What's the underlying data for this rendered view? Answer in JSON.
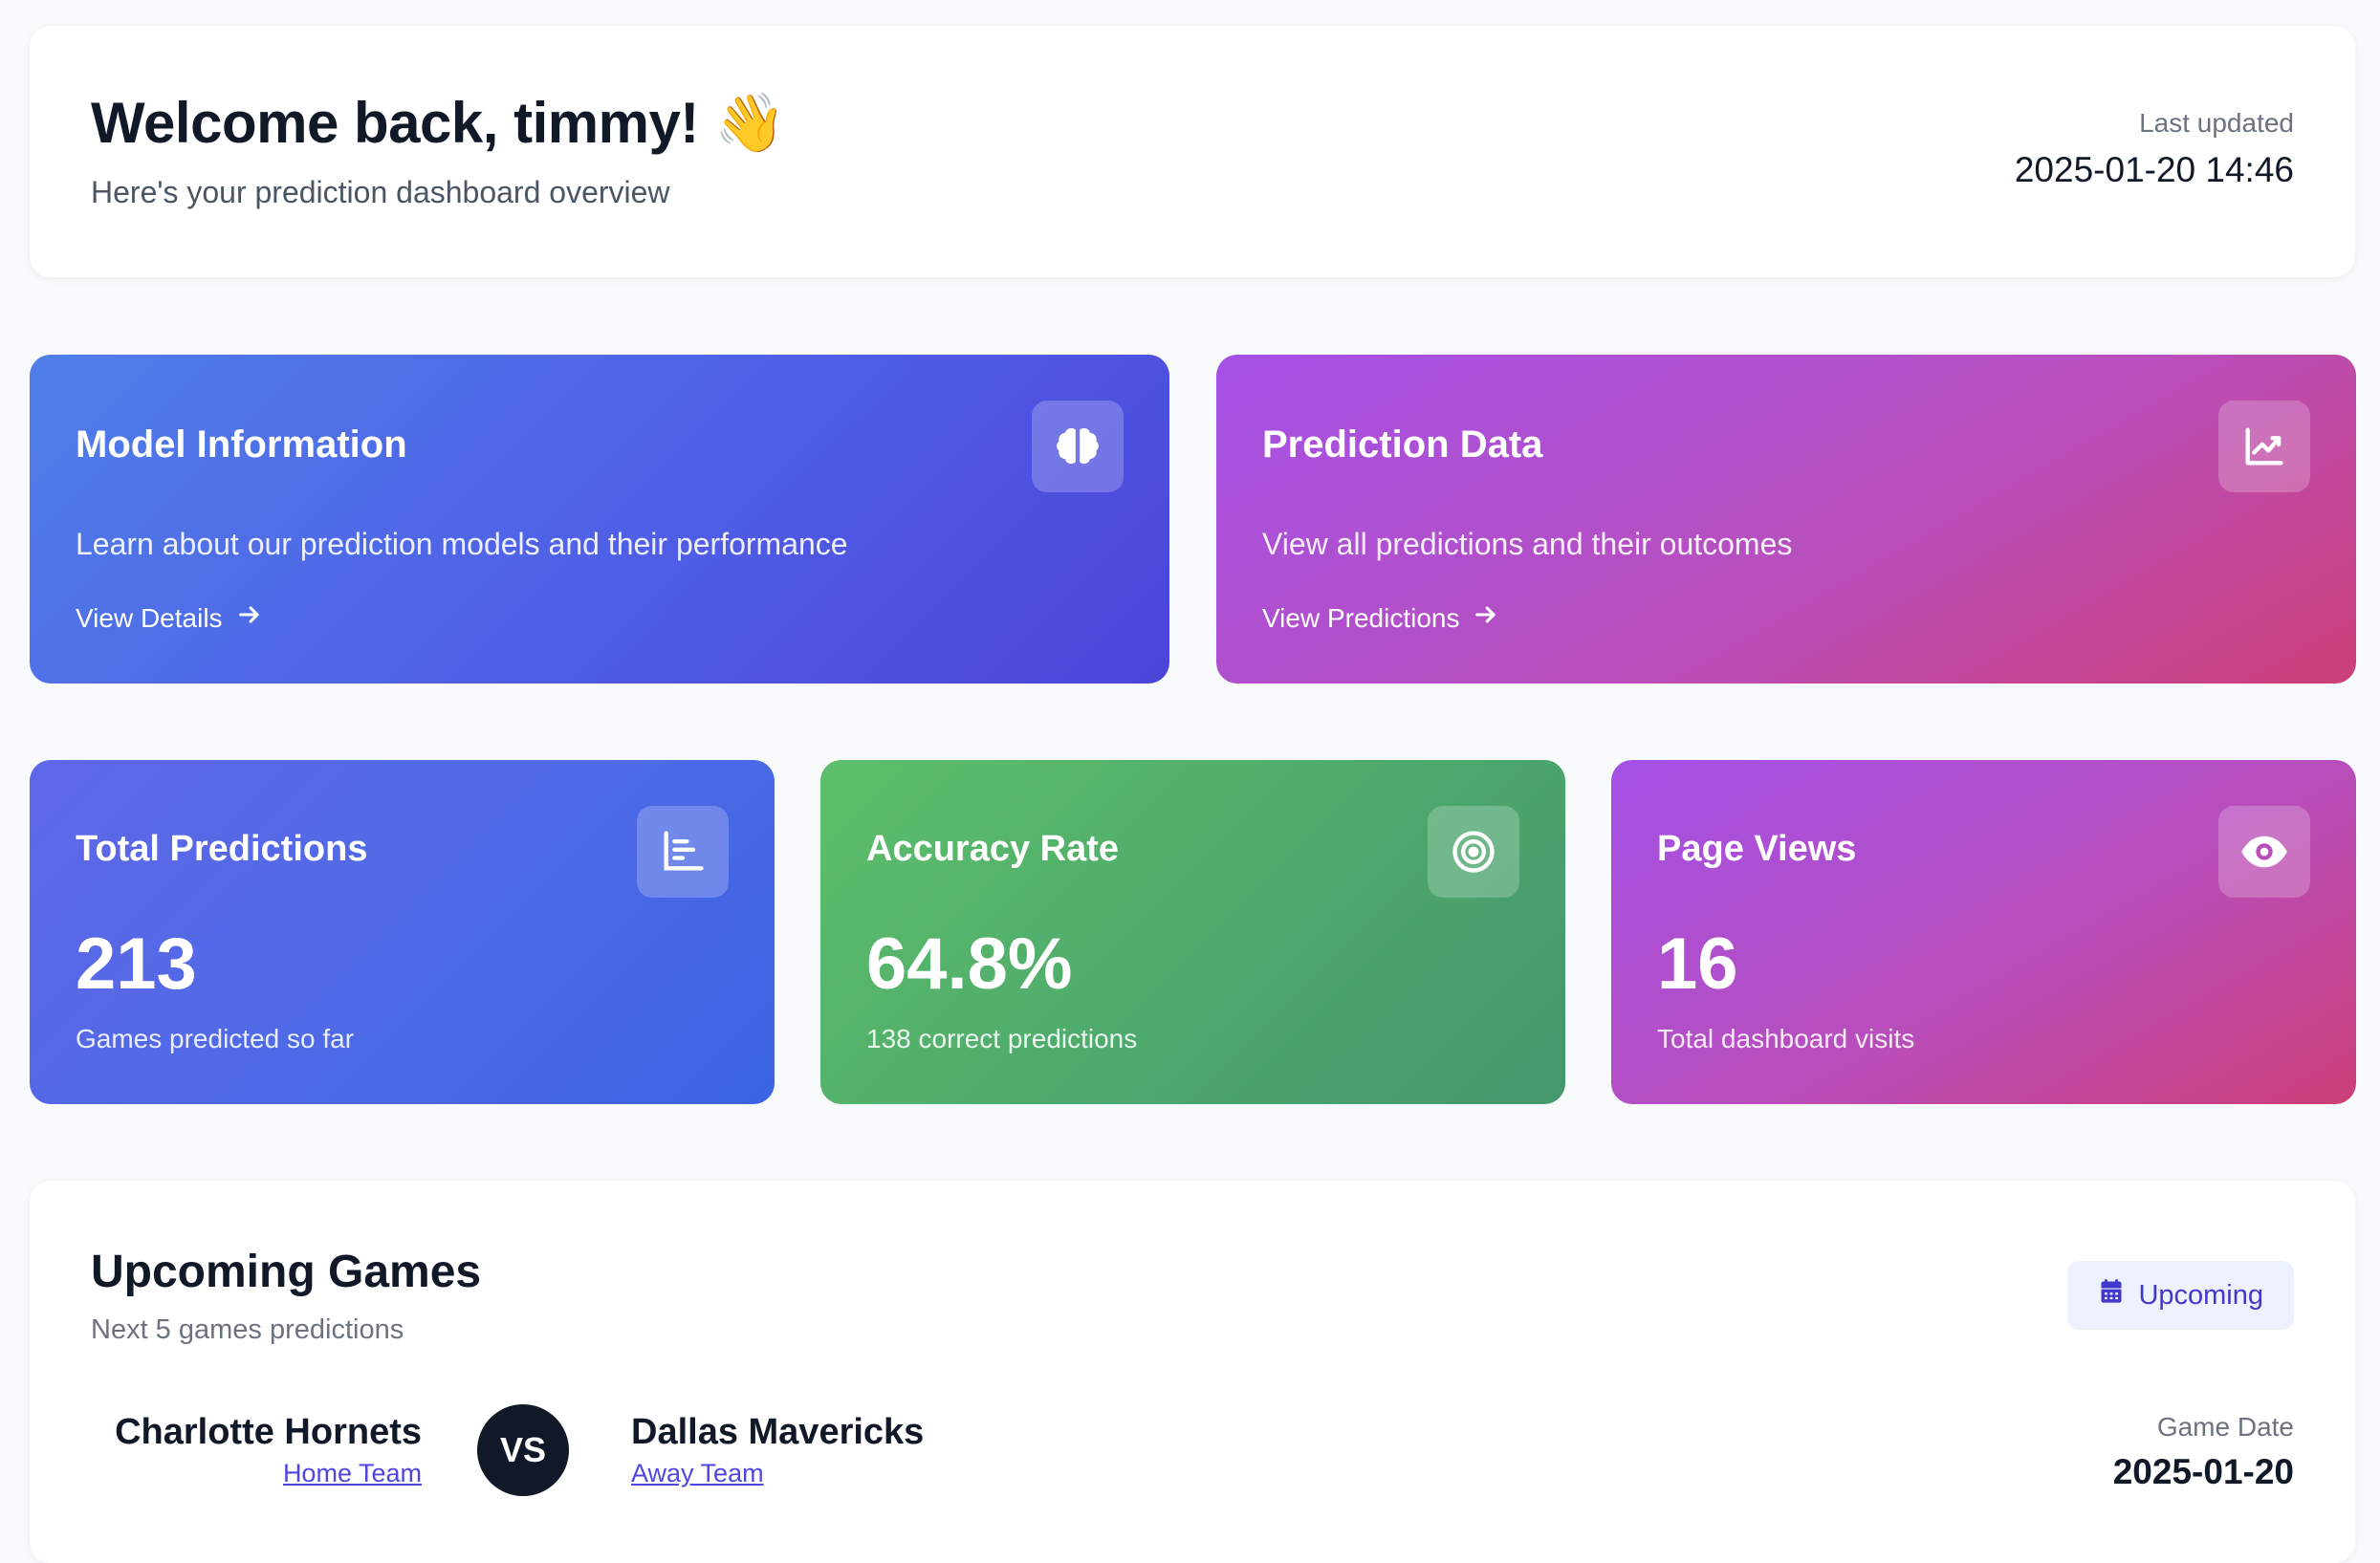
{
  "header": {
    "welcome": "Welcome back, timmy! 👋",
    "subtitle": "Here's your prediction dashboard overview",
    "last_updated_label": "Last updated",
    "last_updated_value": "2025-01-20 14:46"
  },
  "nav_cards": [
    {
      "title": "Model Information",
      "description": "Learn about our prediction models and their performance",
      "link_label": "View Details",
      "icon": "brain-icon",
      "link_icon": "arrow-right-icon"
    },
    {
      "title": "Prediction Data",
      "description": "View all predictions and their outcomes",
      "link_label": "View Predictions",
      "icon": "chart-line-icon",
      "link_icon": "arrow-right-icon"
    }
  ],
  "stats": [
    {
      "title": "Total Predictions",
      "value": "213",
      "subtitle": "Games predicted so far",
      "icon": "bar-chart-icon"
    },
    {
      "title": "Accuracy Rate",
      "value": "64.8%",
      "subtitle": "138 correct predictions",
      "icon": "target-icon"
    },
    {
      "title": "Page Views",
      "value": "16",
      "subtitle": "Total dashboard visits",
      "icon": "eye-icon"
    }
  ],
  "upcoming": {
    "title": "Upcoming Games",
    "subtitle": "Next 5 games predictions",
    "badge_label": "Upcoming",
    "badge_icon": "calendar-icon",
    "games": [
      {
        "home_team": "Charlotte Hornets",
        "home_label": "Home Team",
        "vs_label": "VS",
        "away_team": "Dallas Mavericks",
        "away_label": "Away Team",
        "date_label": "Game Date",
        "date": "2025-01-20"
      }
    ]
  },
  "colors": {
    "accent": "#4f46e5",
    "text_primary": "#111827",
    "text_muted": "#6b7280",
    "badge_bg": "#eef2ff"
  }
}
